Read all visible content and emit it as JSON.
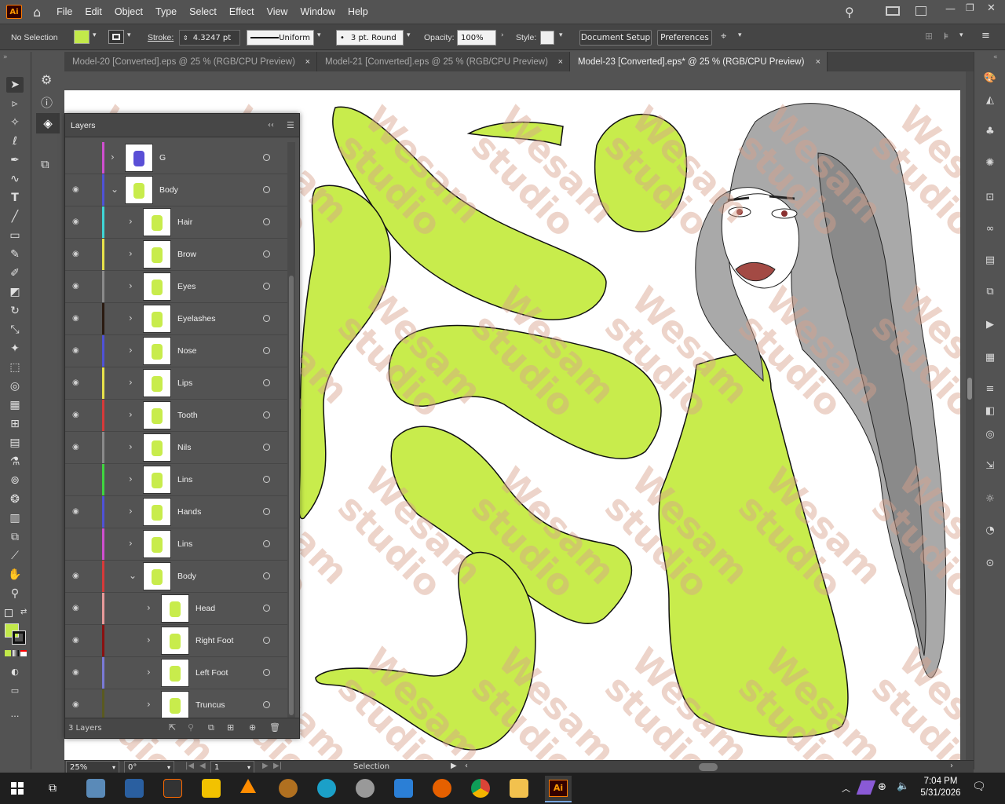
{
  "app": {
    "logo_text": "Ai",
    "brand_color": "#ff9a00"
  },
  "menu": [
    "File",
    "Edit",
    "Object",
    "Type",
    "Select",
    "Effect",
    "View",
    "Window",
    "Help"
  ],
  "control": {
    "selection": "No Selection",
    "fill_color": "#c2e94a",
    "stroke_label": "Stroke:",
    "stroke_value": "4.3247 pt",
    "profile": "Uniform",
    "brush": "3 pt. Round",
    "opacity_label": "Opacity:",
    "opacity_value": "100%",
    "style_label": "Style:",
    "doc_setup": "Document Setup",
    "preferences": "Preferences"
  },
  "tabs": [
    {
      "label": "Model-20 [Converted].eps @ 25 % (RGB/CPU Preview)",
      "close": "×"
    },
    {
      "label": "Model-21 [Converted].eps @ 25 % (RGB/CPU Preview)",
      "close": "×"
    },
    {
      "label": "Model-23 [Converted].eps* @ 25 % (RGB/CPU Preview)",
      "close": "×"
    }
  ],
  "layers_panel": {
    "title": "Layers",
    "collapse": "‹‹",
    "menu": "☰",
    "footer": "3 Layers",
    "rows": [
      {
        "name": "G",
        "color": "#d04fd0",
        "indent": 0,
        "eye": false,
        "expanded": false
      },
      {
        "name": "Body",
        "color": "#4f52d6",
        "indent": 0,
        "eye": true,
        "expanded": true
      },
      {
        "name": "Hair",
        "color": "#3fd6d6",
        "indent": 1,
        "eye": true,
        "expanded": false
      },
      {
        "name": "Brow",
        "color": "#e7e24a",
        "indent": 1,
        "eye": true,
        "expanded": false
      },
      {
        "name": "Eyes",
        "color": "#8a8a8a",
        "indent": 1,
        "eye": true,
        "expanded": false
      },
      {
        "name": "Eyelashes",
        "color": "#2a1a10",
        "indent": 1,
        "eye": true,
        "expanded": false
      },
      {
        "name": "Nose",
        "color": "#4f52d6",
        "indent": 1,
        "eye": true,
        "expanded": false
      },
      {
        "name": "Lips",
        "color": "#e7e24a",
        "indent": 1,
        "eye": true,
        "expanded": false
      },
      {
        "name": "Tooth",
        "color": "#d63a3a",
        "indent": 1,
        "eye": true,
        "expanded": false
      },
      {
        "name": "Nils",
        "color": "#8a8a8a",
        "indent": 1,
        "eye": true,
        "expanded": false
      },
      {
        "name": "Lins",
        "color": "#3fd63f",
        "indent": 1,
        "eye": false,
        "expanded": false
      },
      {
        "name": "Hands",
        "color": "#4f52d6",
        "indent": 1,
        "eye": true,
        "expanded": false
      },
      {
        "name": "Lins",
        "color": "#d04fd0",
        "indent": 1,
        "eye": false,
        "expanded": false
      },
      {
        "name": "Body",
        "color": "#d63a3a",
        "indent": 1,
        "eye": true,
        "expanded": true
      },
      {
        "name": "Head",
        "color": "#e79a9a",
        "indent": 2,
        "eye": true,
        "expanded": false
      },
      {
        "name": "Right Foot",
        "color": "#8a1010",
        "indent": 2,
        "eye": true,
        "expanded": false
      },
      {
        "name": "Left Foot",
        "color": "#7a7ad6",
        "indent": 2,
        "eye": true,
        "expanded": false
      },
      {
        "name": "Truncus",
        "color": "#5a5a20",
        "indent": 2,
        "eye": true,
        "expanded": false
      }
    ]
  },
  "status": {
    "zoom": "25%",
    "rotation": "0°",
    "artboard": "1",
    "tool": "Selection"
  },
  "watermark": "Wesam studio",
  "taskbar": {
    "time": "7:04 PM",
    "date": "5/31/2026"
  }
}
